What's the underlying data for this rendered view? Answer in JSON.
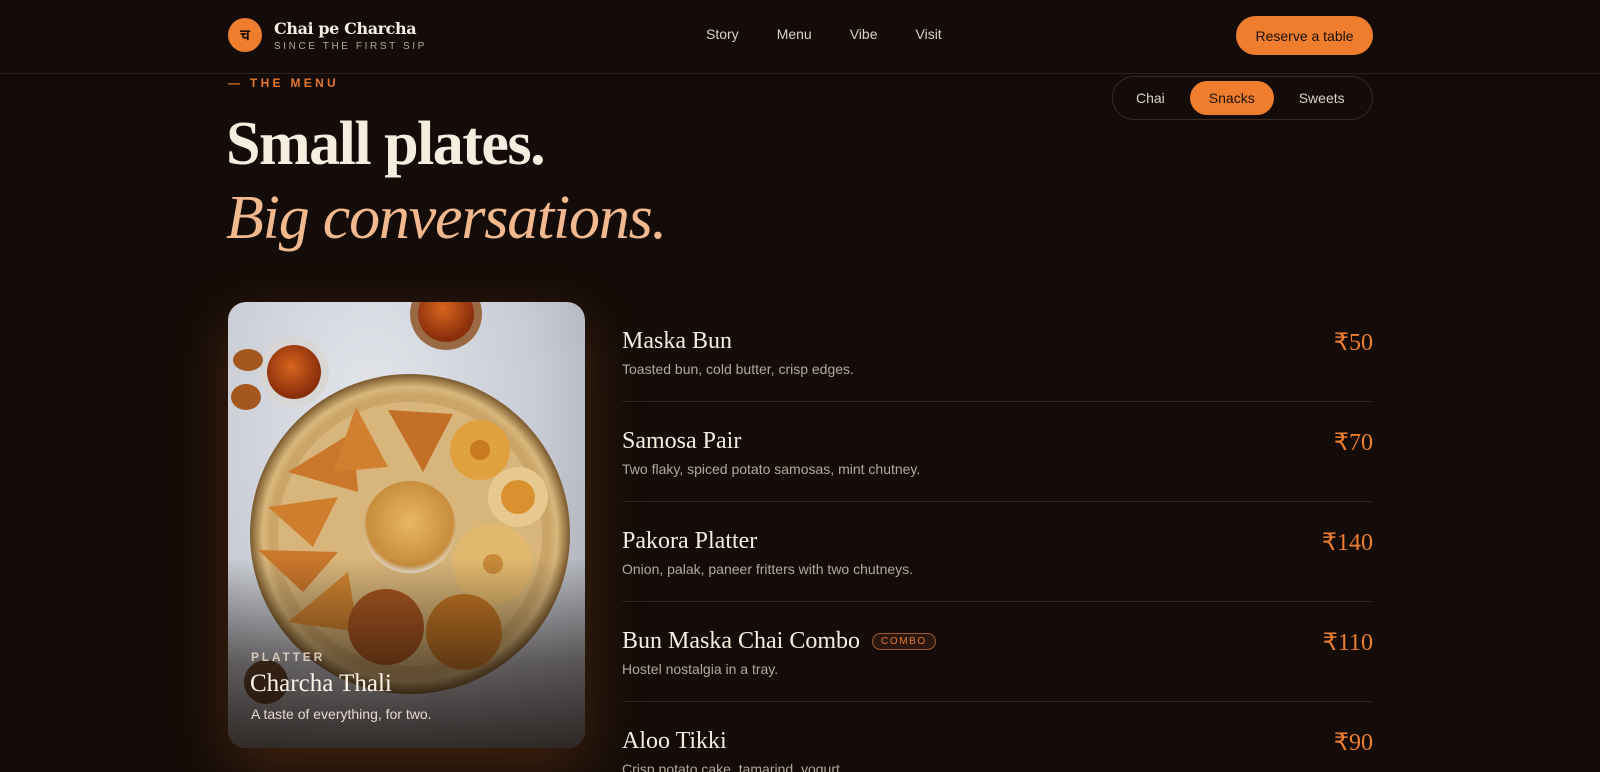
{
  "brand": {
    "logo_glyph": "च",
    "name": "Chai pe Charcha",
    "tagline": "SINCE THE FIRST SIP"
  },
  "nav": {
    "links": [
      "Story",
      "Menu",
      "Vibe",
      "Visit"
    ],
    "cta": "Reserve a table"
  },
  "section": {
    "eyebrow": "— THE MENU",
    "headline": "Small plates.",
    "headline_italic": "Big conversations."
  },
  "categories": {
    "options": [
      "Chai",
      "Snacks",
      "Sweets"
    ],
    "selected": "Snacks"
  },
  "feature": {
    "tag": "PLATTER",
    "title": "Charcha Thali",
    "description": "A taste of everything, for two."
  },
  "menu_items": [
    {
      "name": "Maska Bun",
      "description": "Toasted bun, cold butter, crisp edges.",
      "price": "₹50",
      "badge": ""
    },
    {
      "name": "Samosa Pair",
      "description": "Two flaky, spiced potato samosas, mint chutney.",
      "price": "₹70",
      "badge": ""
    },
    {
      "name": "Pakora Platter",
      "description": "Onion, palak, paneer fritters with two chutneys.",
      "price": "₹140",
      "badge": ""
    },
    {
      "name": "Bun Maska Chai Combo",
      "description": "Hostel nostalgia in a tray.",
      "price": "₹110",
      "badge": "COMBO"
    },
    {
      "name": "Aloo Tikki",
      "description": "Crisp potato cake, tamarind, yogurt.",
      "price": "₹90",
      "badge": ""
    }
  ],
  "colors": {
    "accent": "#ee7d2e",
    "background": "#140c08",
    "italic_headline": "#f2b98e"
  }
}
